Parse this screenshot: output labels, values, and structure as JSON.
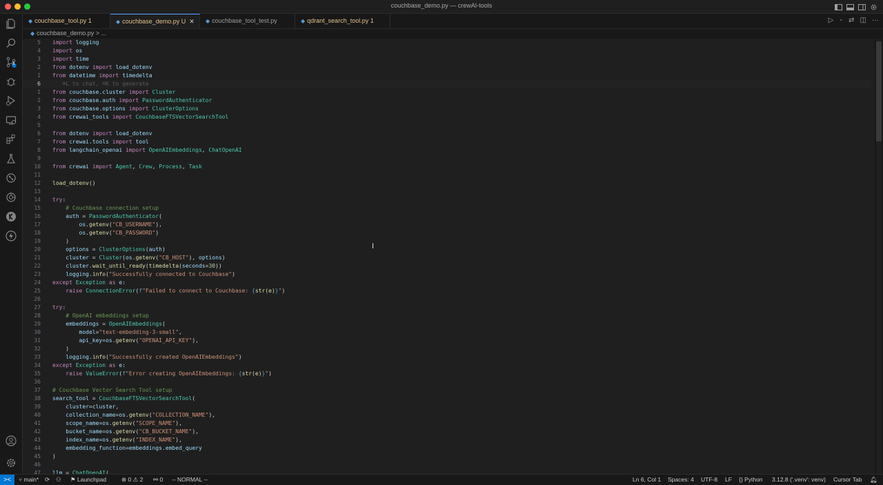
{
  "window": {
    "title": "couchbase_demo.py — crewAI-tools"
  },
  "tabs": [
    {
      "label": "couchbase_tool.py",
      "badge": "1",
      "style": "yellow"
    },
    {
      "label": "couchbase_demo.py",
      "badge": "U",
      "style": "yellow",
      "active": true
    },
    {
      "label": "couchbase_tool_test.py",
      "badge": "",
      "style": "gray"
    },
    {
      "label": "qdrant_search_tool.py",
      "badge": "1",
      "style": "yellow"
    }
  ],
  "breadcrumb": {
    "file": "couchbase_demo.py",
    "sep": ">",
    "more": "..."
  },
  "editor": {
    "inline_hint": "⌘L to chat, ⌘K to generate",
    "lines": [
      {
        "n": "5",
        "text": "import logging"
      },
      {
        "n": "4",
        "text": "import os"
      },
      {
        "n": "3",
        "text": "import time"
      },
      {
        "n": "2",
        "text": "from dotenv import load_dotenv"
      },
      {
        "n": "1",
        "text": "from datetime import timedelta"
      },
      {
        "n": "6",
        "text": "",
        "current": true
      },
      {
        "n": "1",
        "text": "from couchbase.cluster import Cluster"
      },
      {
        "n": "2",
        "text": "from couchbase.auth import PasswordAuthenticator"
      },
      {
        "n": "3",
        "text": "from couchbase.options import ClusterOptions"
      },
      {
        "n": "4",
        "text": "from crewai_tools import CouchbaseFTSVectorSearchTool"
      },
      {
        "n": "5",
        "text": ""
      },
      {
        "n": "6",
        "text": "from dotenv import load_dotenv"
      },
      {
        "n": "7",
        "text": "from crewai.tools import tool"
      },
      {
        "n": "8",
        "text": "from langchain_openai import OpenAIEmbeddings, ChatOpenAI"
      },
      {
        "n": "9",
        "text": ""
      },
      {
        "n": "10",
        "text": "from crewai import Agent, Crew, Process, Task"
      },
      {
        "n": "11",
        "text": ""
      },
      {
        "n": "12",
        "text": "load_dotenv()"
      },
      {
        "n": "13",
        "text": ""
      },
      {
        "n": "14",
        "text": "try:"
      },
      {
        "n": "15",
        "text": "    # Couchbase connection setup"
      },
      {
        "n": "16",
        "text": "    auth = PasswordAuthenticator("
      },
      {
        "n": "17",
        "text": "        os.getenv(\"CB_USERNAME\"),"
      },
      {
        "n": "18",
        "text": "        os.getenv(\"CB_PASSWORD\")"
      },
      {
        "n": "19",
        "text": "    )"
      },
      {
        "n": "20",
        "text": "    options = ClusterOptions(auth)"
      },
      {
        "n": "21",
        "text": "    cluster = Cluster(os.getenv(\"CB_HOST\"), options)"
      },
      {
        "n": "22",
        "text": "    cluster.wait_until_ready(timedelta(seconds=30))"
      },
      {
        "n": "23",
        "text": "    logging.info(\"Successfully connected to Couchbase\")"
      },
      {
        "n": "24",
        "text": "except Exception as e:"
      },
      {
        "n": "25",
        "text": "    raise ConnectionError(f\"Failed to connect to Couchbase: {str(e)}\")"
      },
      {
        "n": "26",
        "text": ""
      },
      {
        "n": "27",
        "text": "try:"
      },
      {
        "n": "28",
        "text": "    # OpenAI embeddings setup"
      },
      {
        "n": "29",
        "text": "    embeddings = OpenAIEmbeddings("
      },
      {
        "n": "30",
        "text": "        model=\"text-embedding-3-small\","
      },
      {
        "n": "31",
        "text": "        api_key=os.getenv(\"OPENAI_API_KEY\"),"
      },
      {
        "n": "32",
        "text": "    )"
      },
      {
        "n": "33",
        "text": "    logging.info(\"Successfully created OpenAIEmbeddings\")"
      },
      {
        "n": "34",
        "text": "except Exception as e:"
      },
      {
        "n": "35",
        "text": "    raise ValueError(f\"Error creating OpenAIEmbeddings: {str(e)}\")"
      },
      {
        "n": "36",
        "text": ""
      },
      {
        "n": "37",
        "text": "# Couchbase Vector Search Tool setup"
      },
      {
        "n": "38",
        "text": "search_tool = CouchbaseFTSVectorSearchTool("
      },
      {
        "n": "39",
        "text": "    cluster=cluster,"
      },
      {
        "n": "40",
        "text": "    collection_name=os.getenv(\"COLLECTION_NAME\"),"
      },
      {
        "n": "41",
        "text": "    scope_name=os.getenv(\"SCOPE_NAME\"),"
      },
      {
        "n": "42",
        "text": "    bucket_name=os.getenv(\"CB_BUCKET_NAME\"),"
      },
      {
        "n": "43",
        "text": "    index_name=os.getenv(\"INDEX_NAME\"),"
      },
      {
        "n": "44",
        "text": "    embedding_function=embeddings.embed_query"
      },
      {
        "n": "45",
        "text": ")"
      },
      {
        "n": "46",
        "text": ""
      },
      {
        "n": "47",
        "text": "llm = ChatOpenAI("
      }
    ]
  },
  "activity_icons": [
    "explorer-icon",
    "search-icon",
    "source-control-icon",
    "debug-icon",
    "run-debug-icon",
    "remote-explorer-icon",
    "extensions-icon",
    "testing-icon",
    "git-graph-icon",
    "docker-icon",
    "kilo-icon",
    "lightning-icon"
  ],
  "source_control_badge": "3",
  "status": {
    "remote": "><",
    "branch": "main*",
    "launchpad": "Launchpad",
    "problems_errors": "0",
    "problems_warnings": "2",
    "ports": "0",
    "vim_mode": "-- NORMAL --",
    "position": "Ln 6, Col 1",
    "spaces": "Spaces: 4",
    "encoding": "UTF-8",
    "eol": "LF",
    "language": "Python",
    "interpreter": "3.12.8 ('.venv': venv)",
    "cursor_tab": "Cursor Tab"
  },
  "colors": {
    "accent": "#0078d4",
    "background": "#1f1f1f",
    "sidebar": "#181818"
  }
}
